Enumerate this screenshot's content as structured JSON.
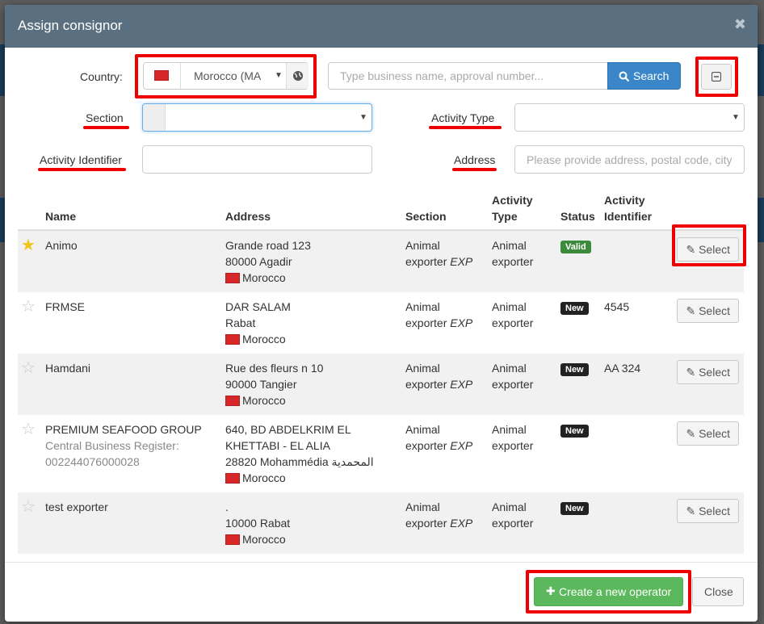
{
  "dialog": {
    "title": "Assign consignor",
    "close_glyph": "✖"
  },
  "filters": {
    "country_label": "Country:",
    "country_value": "Morocco (MA",
    "search_placeholder": "Type business name, approval number...",
    "search_button": "Search",
    "section_label": "Section",
    "section_value": "",
    "activity_type_label": "Activity Type",
    "activity_type_value": "",
    "activity_identifier_label": "Activity Identifier",
    "activity_identifier_value": "",
    "address_label": "Address",
    "address_placeholder": "Please provide address, postal code, city"
  },
  "table": {
    "headers": {
      "name": "Name",
      "address": "Address",
      "section": "Section",
      "activity_type_1": "Activity",
      "activity_type_2": "Type",
      "status": "Status",
      "activity_identifier_1": "Activity",
      "activity_identifier_2": "Identifier"
    },
    "rows": [
      {
        "favorite": true,
        "name": "Animo",
        "name_extra_1": "",
        "name_extra_2": "",
        "addr1": "Grande road 123",
        "addr2": "80000 Agadir",
        "addr3": "",
        "country": "Morocco",
        "section_1": "Animal",
        "section_2": "exporter",
        "section_code": "EXP",
        "type_1": "Animal",
        "type_2": "exporter",
        "status": "Valid",
        "identifier": "",
        "select": "Select"
      },
      {
        "favorite": false,
        "name": "FRMSE",
        "name_extra_1": "",
        "name_extra_2": "",
        "addr1": "DAR SALAM",
        "addr2": "Rabat",
        "addr3": "",
        "country": "Morocco",
        "section_1": "Animal",
        "section_2": "exporter",
        "section_code": "EXP",
        "type_1": "Animal",
        "type_2": "exporter",
        "status": "New",
        "identifier": "4545",
        "select": "Select"
      },
      {
        "favorite": false,
        "name": "Hamdani",
        "name_extra_1": "",
        "name_extra_2": "",
        "addr1": "Rue des fleurs n 10",
        "addr2": "90000 Tangier",
        "addr3": "",
        "country": "Morocco",
        "section_1": "Animal",
        "section_2": "exporter",
        "section_code": "EXP",
        "type_1": "Animal",
        "type_2": "exporter",
        "status": "New",
        "identifier": "AA 324",
        "select": "Select"
      },
      {
        "favorite": false,
        "name": "PREMIUM SEAFOOD GROUP",
        "name_extra_1": "Central Business Register:",
        "name_extra_2": "002244076000028",
        "addr1": "640, BD ABDELKRIM EL",
        "addr2": "KHETTABI - EL ALIA",
        "addr3": "28820 Mohammédia المحمدية",
        "country": "Morocco",
        "section_1": "Animal",
        "section_2": "exporter",
        "section_code": "EXP",
        "type_1": "Animal",
        "type_2": "exporter",
        "status": "New",
        "identifier": "",
        "select": "Select"
      },
      {
        "favorite": false,
        "name": "test exporter",
        "name_extra_1": "",
        "name_extra_2": "",
        "addr1": ".",
        "addr2": "10000 Rabat",
        "addr3": "",
        "country": "Morocco",
        "section_1": "Animal",
        "section_2": "exporter",
        "section_code": "EXP",
        "type_1": "Animal",
        "type_2": "exporter",
        "status": "New",
        "identifier": "",
        "select": "Select"
      }
    ]
  },
  "footer": {
    "create_button": "Create a new operator",
    "close_button": "Close"
  },
  "colors": {
    "header": "#5a7080",
    "primary": "#3a86c8",
    "success": "#5cb85c",
    "highlight": "#e00000"
  }
}
